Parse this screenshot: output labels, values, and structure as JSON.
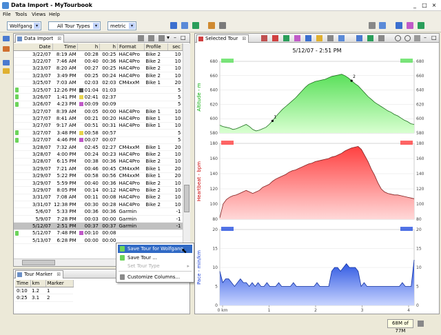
{
  "window": {
    "title": "Data Import - MyTourbook"
  },
  "menu": [
    "File",
    "Tools",
    "Views",
    "Help"
  ],
  "toolbar": {
    "person": "Wolfgang",
    "tour_types": "All Tour Types",
    "measurement": "metric"
  },
  "import_view": {
    "tab_label": "Data Import",
    "columns": [
      "Date",
      "Time",
      "h",
      "h",
      "Format",
      "Profile",
      "sec"
    ],
    "rows": [
      {
        "date": "3/22/07",
        "time": "8:19 AM",
        "h1": "00:28",
        "h2": "00:25",
        "format": "HAC4Pro",
        "profile": "Bike 2",
        "sec": "10",
        "marker": ""
      },
      {
        "date": "3/22/07",
        "time": "7:46 AM",
        "h1": "00:40",
        "h2": "00:36",
        "format": "HAC4Pro",
        "profile": "Bike 2",
        "sec": "10",
        "marker": ""
      },
      {
        "date": "3/23/07",
        "time": "8:20 AM",
        "h1": "00:27",
        "h2": "00:25",
        "format": "HAC4Pro",
        "profile": "Bike 2",
        "sec": "10",
        "marker": ""
      },
      {
        "date": "3/23/07",
        "time": "3:49 PM",
        "h1": "00:25",
        "h2": "00:24",
        "format": "HAC4Pro",
        "profile": "Bike 2",
        "sec": "10",
        "marker": ""
      },
      {
        "date": "3/25/07",
        "time": "7:03 AM",
        "h1": "02:03",
        "h2": "02:03",
        "format": "CM4xxM",
        "profile": "Bike 1",
        "sec": "20",
        "marker": ""
      },
      {
        "date": "3/25/07",
        "time": "12:26 PM",
        "h1": "01:04",
        "h2": "01:03",
        "format": "",
        "profile": "",
        "sec": "5",
        "marker": "#555555"
      },
      {
        "date": "3/26/07",
        "time": "1:41 PM",
        "h1": "02:41",
        "h2": "02:37",
        "format": "",
        "profile": "",
        "sec": "5",
        "marker": "#e8d44d"
      },
      {
        "date": "3/26/07",
        "time": "4:23 PM",
        "h1": "00:09",
        "h2": "00:09",
        "format": "",
        "profile": "",
        "sec": "5",
        "marker": "#c05ac8"
      },
      {
        "date": "3/27/07",
        "time": "8:39 AM",
        "h1": "00:05",
        "h2": "00:00",
        "format": "HAC4Pro",
        "profile": "Bike 1",
        "sec": "10",
        "marker": ""
      },
      {
        "date": "3/27/07",
        "time": "8:41 AM",
        "h1": "00:21",
        "h2": "00:20",
        "format": "HAC4Pro",
        "profile": "Bike 1",
        "sec": "10",
        "marker": ""
      },
      {
        "date": "3/27/07",
        "time": "9:17 AM",
        "h1": "00:51",
        "h2": "00:31",
        "format": "HAC4Pro",
        "profile": "Bike 1",
        "sec": "10",
        "marker": ""
      },
      {
        "date": "3/27/07",
        "time": "3:48 PM",
        "h1": "00:58",
        "h2": "00:57",
        "format": "",
        "profile": "",
        "sec": "5",
        "marker": "#e8d44d"
      },
      {
        "date": "3/27/07",
        "time": "4:46 PM",
        "h1": "00:07",
        "h2": "00:07",
        "format": "",
        "profile": "",
        "sec": "5",
        "marker": "#c05ac8"
      },
      {
        "date": "3/28/07",
        "time": "7:32 AM",
        "h1": "02:45",
        "h2": "02:27",
        "format": "CM4xxM",
        "profile": "Bike 1",
        "sec": "20",
        "marker": ""
      },
      {
        "date": "3/28/07",
        "time": "4:00 PM",
        "h1": "00:24",
        "h2": "00:23",
        "format": "HAC4Pro",
        "profile": "Bike 2",
        "sec": "10",
        "marker": ""
      },
      {
        "date": "3/28/07",
        "time": "6:15 PM",
        "h1": "00:38",
        "h2": "00:36",
        "format": "HAC4Pro",
        "profile": "Bike 2",
        "sec": "10",
        "marker": ""
      },
      {
        "date": "3/29/07",
        "time": "7:21 AM",
        "h1": "00:46",
        "h2": "00:45",
        "format": "CM4xxM",
        "profile": "Bike 1",
        "sec": "20",
        "marker": ""
      },
      {
        "date": "3/29/07",
        "time": "5:22 PM",
        "h1": "00:58",
        "h2": "00:56",
        "format": "CM4xxM",
        "profile": "Bike 1",
        "sec": "20",
        "marker": ""
      },
      {
        "date": "3/29/07",
        "time": "5:59 PM",
        "h1": "00:40",
        "h2": "00:36",
        "format": "HAC4Pro",
        "profile": "Bike 2",
        "sec": "10",
        "marker": ""
      },
      {
        "date": "3/29/07",
        "time": "8:05 PM",
        "h1": "00:14",
        "h2": "00:12",
        "format": "HAC4Pro",
        "profile": "Bike 2",
        "sec": "10",
        "marker": ""
      },
      {
        "date": "3/31/07",
        "time": "7:08 AM",
        "h1": "00:11",
        "h2": "00:08",
        "format": "HAC4Pro",
        "profile": "Bike 2",
        "sec": "10",
        "marker": ""
      },
      {
        "date": "3/31/07",
        "time": "12:38 PM",
        "h1": "00:30",
        "h2": "00:28",
        "format": "HAC4Pro",
        "profile": "Bike 2",
        "sec": "10",
        "marker": ""
      },
      {
        "date": "5/6/07",
        "time": "5:33 PM",
        "h1": "00:36",
        "h2": "00:36",
        "format": "Garmin",
        "profile": "",
        "sec": "-1",
        "marker": ""
      },
      {
        "date": "5/9/07",
        "time": "7:28 PM",
        "h1": "00:03",
        "h2": "00:00",
        "format": "Garmin",
        "profile": "",
        "sec": "-1",
        "marker": ""
      },
      {
        "date": "5/12/07",
        "time": "2:51 PM",
        "h1": "00:37",
        "h2": "00:37",
        "format": "Garmin",
        "profile": "",
        "sec": "-1",
        "marker": "",
        "selected": true
      },
      {
        "date": "5/12/07",
        "time": "7:48 PM",
        "h1": "00:10",
        "h2": "00:08",
        "format": "",
        "profile": "",
        "sec": "",
        "marker": "#c05ac8"
      },
      {
        "date": "5/13/07",
        "time": "6:28 PM",
        "h1": "00:00",
        "h2": "00:00",
        "format": "",
        "profile": "",
        "sec": "",
        "marker": ""
      }
    ]
  },
  "context_menu": {
    "items": [
      {
        "label": "Save Tour for Wolfgang",
        "state": "selected"
      },
      {
        "label": "Save Tour ...",
        "state": "normal"
      },
      {
        "label": "Set Tour Type",
        "state": "disabled"
      },
      {
        "label": "Customize Columns...",
        "state": "normal"
      }
    ]
  },
  "marker_view": {
    "tab_label": "Tour Marker",
    "columns": [
      "Time",
      "km",
      "Marker"
    ],
    "rows": [
      {
        "time": "0:10",
        "km": "1.2",
        "marker": "1"
      },
      {
        "time": "0:25",
        "km": "3.1",
        "marker": "2"
      }
    ]
  },
  "chart_view": {
    "tab_label": "Selected Tour",
    "tour_date": "5/12/07 - 2:51 PM",
    "colors": {
      "altitude": "#00cc00",
      "heartbeat": "#ff3333",
      "pace": "#1a3fd6"
    },
    "altitude": {
      "axis_label": "Altitude - m",
      "y_ticks": [
        "680",
        "660",
        "640",
        "620",
        "600",
        "580"
      ],
      "ylim": [
        580,
        680
      ],
      "markers": [
        "1",
        "2"
      ],
      "values": [
        591,
        589,
        588,
        587,
        585,
        586,
        588,
        590,
        592,
        589,
        585,
        583,
        584,
        586,
        588,
        592,
        597,
        603,
        608,
        613,
        617,
        621,
        625,
        629,
        634,
        639,
        644,
        648,
        650,
        652,
        653,
        654,
        655,
        657,
        659,
        660,
        661,
        662,
        660,
        657,
        653,
        649,
        646,
        641,
        636,
        631,
        627,
        623,
        620,
        617,
        614,
        611,
        609,
        606,
        604,
        601,
        598,
        596,
        593,
        592
      ]
    },
    "heartbeat": {
      "axis_label": "Heartbeat - bpm",
      "y_ticks": [
        "180",
        "160",
        "140",
        "120",
        "100",
        "80"
      ],
      "ylim": [
        80,
        180
      ],
      "values": [
        82,
        100,
        106,
        109,
        111,
        112,
        114,
        116,
        118,
        116,
        114,
        116,
        118,
        122,
        124,
        126,
        130,
        133,
        135,
        137,
        139,
        142,
        144,
        145,
        147,
        149,
        151,
        153,
        154,
        156,
        157,
        158,
        159,
        160,
        162,
        163,
        165,
        167,
        170,
        172,
        174,
        175,
        176,
        172,
        164,
        156,
        146,
        138,
        128,
        120,
        116,
        114,
        113,
        112,
        112,
        111,
        110,
        109,
        108,
        107
      ]
    },
    "pace": {
      "axis_label": "Pace - min/km",
      "y_ticks": [
        "20",
        "15",
        "10",
        "5",
        "0"
      ],
      "ylim": [
        0,
        20
      ],
      "values": [
        9,
        6,
        7,
        7,
        6,
        5,
        6,
        7,
        6,
        6,
        5,
        6,
        5,
        6,
        5,
        5,
        6,
        5,
        5,
        5,
        6,
        5,
        5,
        5,
        5,
        6,
        5,
        5,
        5,
        5,
        5,
        5,
        5,
        6,
        5,
        5,
        5,
        5,
        9,
        10,
        10,
        9,
        10,
        11,
        10,
        10,
        10,
        9,
        5,
        6,
        5,
        5,
        5,
        5,
        5,
        5,
        5,
        5,
        5,
        5,
        5,
        5,
        6,
        5,
        5,
        5,
        12
      ]
    },
    "x_ticks": [
      "0 km",
      "1",
      "2",
      "3",
      "4"
    ]
  },
  "status": {
    "memory": "68M of 77M"
  }
}
